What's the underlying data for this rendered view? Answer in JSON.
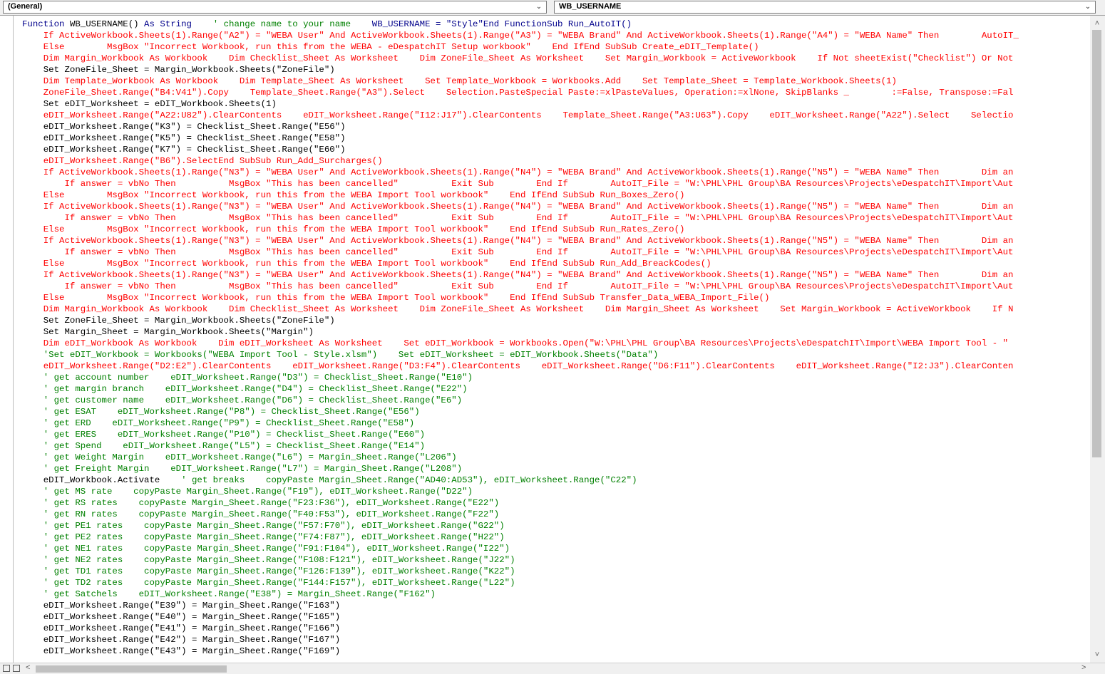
{
  "toolbar": {
    "object_combo": "(General)",
    "procedure_combo": "WB_USERNAME",
    "dropdown_glyph": "⌄"
  },
  "scrollbars": {
    "up_glyph": "˄",
    "down_glyph": "˅",
    "left_glyph": "<",
    "right_glyph": ">"
  },
  "code_lines": [
    {
      "color": "mixed",
      "segments": [
        {
          "c": "kw",
          "t": "Function "
        },
        {
          "c": "blk",
          "t": "WB_USERNAME() "
        },
        {
          "c": "kw",
          "t": "As String"
        },
        {
          "c": "green",
          "t": "    ' change name to your name    "
        },
        {
          "c": "kw",
          "t": "WB_USERNAME = \"Style\"End FunctionSub Run_AutoIT()"
        }
      ]
    },
    {
      "color": "red",
      "indent": "    ",
      "text": "If ActiveWorkbook.Sheets(1).Range(\"A2\") = \"WEBA User\" And ActiveWorkbook.Sheets(1).Range(\"A3\") = \"WEBA Brand\" And ActiveWorkbook.Sheets(1).Range(\"A4\") = \"WEBA Name\" Then        AutoIT_"
    },
    {
      "color": "red",
      "indent": "    ",
      "text": "Else        MsgBox \"Incorrect Workbook, run this from the WEBA - eDespatchIT Setup workbook\"    End IfEnd SubSub Create_eDIT_Template()"
    },
    {
      "color": "red",
      "indent": "    ",
      "text": "Dim Margin_Workbook As Workbook    Dim Checklist_Sheet As Worksheet    Dim ZoneFile_Sheet As Worksheet    Set Margin_Workbook = ActiveWorkbook    If Not sheetExist(\"Checklist\") Or Not"
    },
    {
      "color": "blk",
      "indent": "    ",
      "text": "Set ZoneFile_Sheet = Margin_Workbook.Sheets(\"ZoneFile\")"
    },
    {
      "color": "red",
      "indent": "    ",
      "text": "Dim Template_Workbook As Workbook    Dim Template_Sheet As Worksheet    Set Template_Workbook = Workbooks.Add    Set Template_Sheet = Template_Workbook.Sheets(1)"
    },
    {
      "color": "red",
      "indent": "    ",
      "text": "ZoneFile_Sheet.Range(\"B4:V41\").Copy    Template_Sheet.Range(\"A3\").Select    Selection.PasteSpecial Paste:=xlPasteValues, Operation:=xlNone, SkipBlanks _        :=False, Transpose:=Fal"
    },
    {
      "color": "blk",
      "indent": "    ",
      "text": "Set eDIT_Worksheet = eDIT_Workbook.Sheets(1)"
    },
    {
      "color": "red",
      "indent": "    ",
      "text": "eDIT_Worksheet.Range(\"A22:U82\").ClearContents    eDIT_Worksheet.Range(\"I12:J17\").ClearContents    Template_Sheet.Range(\"A3:U63\").Copy    eDIT_Worksheet.Range(\"A22\").Select    Selectio"
    },
    {
      "color": "blk",
      "indent": "    ",
      "text": "eDIT_Worksheet.Range(\"K3\") = Checklist_Sheet.Range(\"E56\")"
    },
    {
      "color": "blk",
      "indent": "    ",
      "text": "eDIT_Worksheet.Range(\"K5\") = Checklist_Sheet.Range(\"E58\")"
    },
    {
      "color": "blk",
      "indent": "    ",
      "text": "eDIT_Worksheet.Range(\"K7\") = Checklist_Sheet.Range(\"E60\")"
    },
    {
      "color": "red",
      "indent": "    ",
      "text": "eDIT_Worksheet.Range(\"B6\").SelectEnd SubSub Run_Add_Surcharges()"
    },
    {
      "color": "red",
      "indent": "    ",
      "text": "If ActiveWorkbook.Sheets(1).Range(\"N3\") = \"WEBA User\" And ActiveWorkbook.Sheets(1).Range(\"N4\") = \"WEBA Brand\" And ActiveWorkbook.Sheets(1).Range(\"N5\") = \"WEBA Name\" Then        Dim an"
    },
    {
      "color": "red",
      "indent": "        ",
      "text": "If answer = vbNo Then          MsgBox \"This has been cancelled\"          Exit Sub        End If        AutoIT_File = \"W:\\PHL\\PHL Group\\BA Resources\\Projects\\eDespatchIT\\Import\\Aut"
    },
    {
      "color": "red",
      "indent": "    ",
      "text": "Else        MsgBox \"Incorrect Workbook, run this from the WEBA Import Tool workbook\"    End IfEnd SubSub Run_Boxes_Zero()"
    },
    {
      "color": "red",
      "indent": "    ",
      "text": "If ActiveWorkbook.Sheets(1).Range(\"N3\") = \"WEBA User\" And ActiveWorkbook.Sheets(1).Range(\"N4\") = \"WEBA Brand\" And ActiveWorkbook.Sheets(1).Range(\"N5\") = \"WEBA Name\" Then        Dim an"
    },
    {
      "color": "red",
      "indent": "        ",
      "text": "If answer = vbNo Then          MsgBox \"This has been cancelled\"          Exit Sub        End If        AutoIT_File = \"W:\\PHL\\PHL Group\\BA Resources\\Projects\\eDespatchIT\\Import\\Aut"
    },
    {
      "color": "red",
      "indent": "    ",
      "text": "Else        MsgBox \"Incorrect Workbook, run this from the WEBA Import Tool workbook\"    End IfEnd SubSub Run_Rates_Zero()"
    },
    {
      "color": "red",
      "indent": "    ",
      "text": "If ActiveWorkbook.Sheets(1).Range(\"N3\") = \"WEBA User\" And ActiveWorkbook.Sheets(1).Range(\"N4\") = \"WEBA Brand\" And ActiveWorkbook.Sheets(1).Range(\"N5\") = \"WEBA Name\" Then        Dim an"
    },
    {
      "color": "red",
      "indent": "        ",
      "text": "If answer = vbNo Then          MsgBox \"This has been cancelled\"          Exit Sub        End If        AutoIT_File = \"W:\\PHL\\PHL Group\\BA Resources\\Projects\\eDespatchIT\\Import\\Aut"
    },
    {
      "color": "red",
      "indent": "    ",
      "text": "Else        MsgBox \"Incorrect Workbook, run this from the WEBA Import Tool workbook\"    End IfEnd SubSub Run_Add_BreackCodes()"
    },
    {
      "color": "red",
      "indent": "    ",
      "text": "If ActiveWorkbook.Sheets(1).Range(\"N3\") = \"WEBA User\" And ActiveWorkbook.Sheets(1).Range(\"N4\") = \"WEBA Brand\" And ActiveWorkbook.Sheets(1).Range(\"N5\") = \"WEBA Name\" Then        Dim an"
    },
    {
      "color": "red",
      "indent": "        ",
      "text": "If answer = vbNo Then          MsgBox \"This has been cancelled\"          Exit Sub        End If        AutoIT_File = \"W:\\PHL\\PHL Group\\BA Resources\\Projects\\eDespatchIT\\Import\\Aut"
    },
    {
      "color": "red",
      "indent": "    ",
      "text": "Else        MsgBox \"Incorrect Workbook, run this from the WEBA Import Tool workbook\"    End IfEnd SubSub Transfer_Data_WEBA_Import_File()"
    },
    {
      "color": "red",
      "indent": "    ",
      "text": "Dim Margin_Workbook As Workbook    Dim Checklist_Sheet As Worksheet    Dim ZoneFile_Sheet As Worksheet    Dim Margin_Sheet As Worksheet    Set Margin_Workbook = ActiveWorkbook    If N"
    },
    {
      "color": "blk",
      "indent": "    ",
      "text": "Set ZoneFile_Sheet = Margin_Workbook.Sheets(\"ZoneFile\")"
    },
    {
      "color": "blk",
      "indent": "    ",
      "text": "Set Margin_Sheet = Margin_Workbook.Sheets(\"Margin\")"
    },
    {
      "color": "red",
      "indent": "    ",
      "text": "Dim eDIT_Workbook As Workbook    Dim eDIT_Worksheet As Worksheet    Set eDIT_Workbook = Workbooks.Open(\"W:\\PHL\\PHL Group\\BA Resources\\Projects\\eDespatchIT\\Import\\WEBA Import Tool - \""
    },
    {
      "color": "green",
      "indent": "    ",
      "text": "'Set eDIT_Workbook = Workbooks(\"WEBA Import Tool - Style.xlsm\")    Set eDIT_Worksheet = eDIT_Workbook.Sheets(\"Data\")"
    },
    {
      "color": "red",
      "indent": "    ",
      "text": "eDIT_Worksheet.Range(\"D2:E2\").ClearContents    eDIT_Worksheet.Range(\"D3:F4\").ClearContents    eDIT_Worksheet.Range(\"D6:F11\").ClearContents    eDIT_Worksheet.Range(\"I2:J3\").ClearConten"
    },
    {
      "color": "green",
      "indent": "    ",
      "text": "' get account number    eDIT_Worksheet.Range(\"D3\") = Checklist_Sheet.Range(\"E10\")"
    },
    {
      "color": "green",
      "indent": "    ",
      "text": "' get margin branch    eDIT_Worksheet.Range(\"D4\") = Checklist_Sheet.Range(\"E22\")"
    },
    {
      "color": "green",
      "indent": "    ",
      "text": "' get customer name    eDIT_Worksheet.Range(\"D6\") = Checklist_Sheet.Range(\"E6\")"
    },
    {
      "color": "green",
      "indent": "    ",
      "text": "' get ESAT    eDIT_Worksheet.Range(\"P8\") = Checklist_Sheet.Range(\"E56\")"
    },
    {
      "color": "green",
      "indent": "    ",
      "text": "' get ERD    eDIT_Worksheet.Range(\"P9\") = Checklist_Sheet.Range(\"E58\")"
    },
    {
      "color": "green",
      "indent": "    ",
      "text": "' get ERES    eDIT_Worksheet.Range(\"P10\") = Checklist_Sheet.Range(\"E60\")"
    },
    {
      "color": "green",
      "indent": "    ",
      "text": "' get Spend    eDIT_Worksheet.Range(\"L5\") = Checklist_Sheet.Range(\"E14\")"
    },
    {
      "color": "green",
      "indent": "    ",
      "text": "' get Weight Margin    eDIT_Worksheet.Range(\"L6\") = Margin_Sheet.Range(\"L206\")"
    },
    {
      "color": "green",
      "indent": "    ",
      "text": "' get Freight Margin    eDIT_Worksheet.Range(\"L7\") = Margin_Sheet.Range(\"L208\")"
    },
    {
      "color": "mixed",
      "segments": [
        {
          "c": "blk",
          "t": "    eDIT_Workbook.Activate"
        },
        {
          "c": "green",
          "t": "    ' get breaks    copyPaste Margin_Sheet.Range(\"AD40:AD53\"), eDIT_Worksheet.Range(\"C22\")"
        }
      ]
    },
    {
      "color": "green",
      "indent": "    ",
      "text": "' get MS rate    copyPaste Margin_Sheet.Range(\"F19\"), eDIT_Worksheet.Range(\"D22\")"
    },
    {
      "color": "green",
      "indent": "    ",
      "text": "' get RS rates    copyPaste Margin_Sheet.Range(\"F23:F36\"), eDIT_Worksheet.Range(\"E22\")"
    },
    {
      "color": "green",
      "indent": "    ",
      "text": "' get RN rates    copyPaste Margin_Sheet.Range(\"F40:F53\"), eDIT_Worksheet.Range(\"F22\")"
    },
    {
      "color": "green",
      "indent": "    ",
      "text": "' get PE1 rates    copyPaste Margin_Sheet.Range(\"F57:F70\"), eDIT_Worksheet.Range(\"G22\")"
    },
    {
      "color": "green",
      "indent": "    ",
      "text": "' get PE2 rates    copyPaste Margin_Sheet.Range(\"F74:F87\"), eDIT_Worksheet.Range(\"H22\")"
    },
    {
      "color": "green",
      "indent": "    ",
      "text": "' get NE1 rates    copyPaste Margin_Sheet.Range(\"F91:F104\"), eDIT_Worksheet.Range(\"I22\")"
    },
    {
      "color": "green",
      "indent": "    ",
      "text": "' get NE2 rates    copyPaste Margin_Sheet.Range(\"F108:F121\"), eDIT_Worksheet.Range(\"J22\")"
    },
    {
      "color": "green",
      "indent": "    ",
      "text": "' get TD1 rates    copyPaste Margin_Sheet.Range(\"F126:F139\"), eDIT_Worksheet.Range(\"K22\")"
    },
    {
      "color": "green",
      "indent": "    ",
      "text": "' get TD2 rates    copyPaste Margin_Sheet.Range(\"F144:F157\"), eDIT_Worksheet.Range(\"L22\")"
    },
    {
      "color": "green",
      "indent": "    ",
      "text": "' get Satchels    eDIT_Worksheet.Range(\"E38\") = Margin_Sheet.Range(\"F162\")"
    },
    {
      "color": "blk",
      "indent": "    ",
      "text": "eDIT_Worksheet.Range(\"E39\") = Margin_Sheet.Range(\"F163\")"
    },
    {
      "color": "blk",
      "indent": "    ",
      "text": "eDIT_Worksheet.Range(\"E40\") = Margin_Sheet.Range(\"F165\")"
    },
    {
      "color": "blk",
      "indent": "    ",
      "text": "eDIT_Worksheet.Range(\"E41\") = Margin_Sheet.Range(\"F166\")"
    },
    {
      "color": "blk",
      "indent": "    ",
      "text": "eDIT_Worksheet.Range(\"E42\") = Margin_Sheet.Range(\"F167\")"
    },
    {
      "color": "blk",
      "indent": "    ",
      "text": "eDIT_Worksheet.Range(\"E43\") = Margin_Sheet.Range(\"F169\")"
    }
  ]
}
